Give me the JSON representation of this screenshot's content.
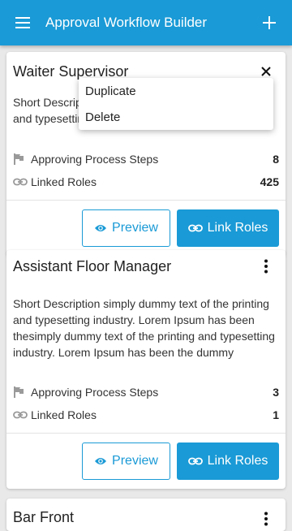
{
  "app": {
    "title": "Approval Workflow Builder"
  },
  "cards": [
    {
      "title": "Waiter Supervisor",
      "description": "Short Description simply dummy text of the printing and typesetting industry.",
      "steps_label": "Approving Process Steps",
      "steps_value": "8",
      "roles_label": "Linked Roles",
      "roles_value": "425",
      "preview_label": "Preview",
      "link_label": "Link Roles"
    },
    {
      "title": "Assistant Floor Manager",
      "description": "Short Description simply dummy text of the printing and typesetting industry. Lorem Ipsum has been thesimply dummy text of the printing and typesetting industry. Lorem Ipsum has been the dummy",
      "steps_label": "Approving Process Steps",
      "steps_value": "3",
      "roles_label": "Linked Roles",
      "roles_value": "1",
      "preview_label": "Preview",
      "link_label": "Link Roles"
    },
    {
      "title": "Bar Front"
    }
  ],
  "popup_menu": {
    "items": [
      "Duplicate",
      "Delete"
    ]
  },
  "colors": {
    "primary": "#1a9ad6",
    "background": "#e9e9e9"
  }
}
